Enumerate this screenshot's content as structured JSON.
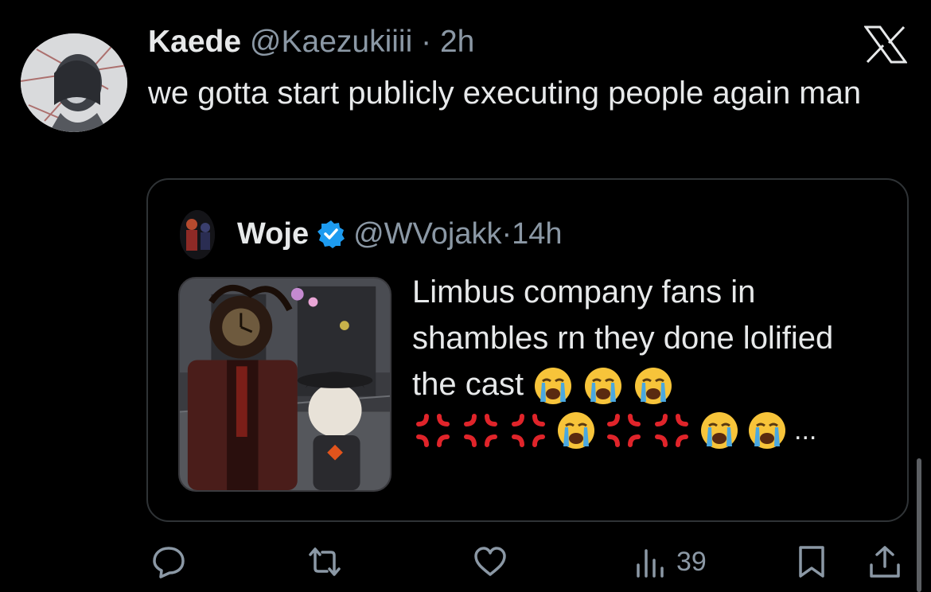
{
  "tweet": {
    "author_name": "Kaede",
    "author_handle": "@Kaezukiiii",
    "separator": "·",
    "time": "2h",
    "text": "we gotta start publicly executing people again man"
  },
  "quote": {
    "author_name": "Woje",
    "author_handle": "@WVojakk",
    "separator": "·",
    "time": "14h",
    "text": "Limbus company fans in shambles rn they done lolified the cast",
    "ellipsis": "...",
    "emoji_line1": [
      "loudly-crying-face",
      "loudly-crying-face",
      "loudly-crying-face"
    ],
    "emoji_line2": [
      "anger-symbol",
      "anger-symbol",
      "anger-symbol",
      "loudly-crying-face",
      "anger-symbol",
      "anger-symbol",
      "loudly-crying-face",
      "loudly-crying-face"
    ]
  },
  "actions": {
    "views_count": "39",
    "icons": [
      "reply-icon",
      "repost-icon",
      "like-icon",
      "views-icon",
      "bookmark-icon",
      "share-icon"
    ]
  },
  "colors": {
    "background": "#000000",
    "text": "#e7e9ea",
    "muted": "#8b98a5",
    "verified": "#1d9bf0",
    "border": "#2f3336"
  }
}
